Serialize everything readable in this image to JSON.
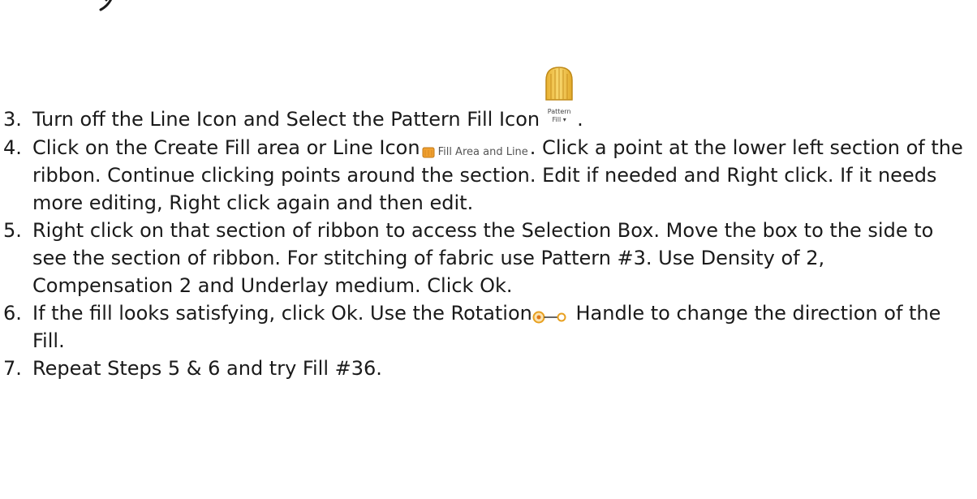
{
  "steps": [
    {
      "number": "3.",
      "text_before": "Turn off the Line Icon and Select the Pattern Fill Icon",
      "icon": "pattern-fill-icon",
      "icon_label_line1": "Pattern",
      "icon_label_line2": "Fill ▾",
      "text_after": "."
    },
    {
      "number": "4.",
      "text_before": "Click on the Create Fill area or Line Icon",
      "icon": "fill-area-and-line-icon",
      "icon_label": "Fill Area and Line",
      "text_after": ".  Click a point at the lower left section of the ribbon.  Continue clicking points around the section.  Edit if needed and Right click.  If it needs more editing, Right click again and then edit."
    },
    {
      "number": "5.",
      "text": "Right click on that section of ribbon to access the Selection Box.  Move the box to the side to see the section of ribbon.  For stitching of fabric use Pattern #3.  Use Density of 2, Compensation 2 and Underlay medium.  Click Ok."
    },
    {
      "number": "6.",
      "text_before": "If the fill looks satisfying, click Ok.  Use the Rotation",
      "icon": "rotation-handle-icon",
      "text_after": " Handle to change the direction of the Fill."
    },
    {
      "number": "7.",
      "text": "Repeat Steps 5 & 6 and try Fill #36."
    }
  ],
  "colors": {
    "text": "#1a1a1a",
    "pattern_fill_icon": "#f2c24a",
    "fill_area_icon": "#f0a030",
    "rotation_handle": "#e8a020"
  }
}
